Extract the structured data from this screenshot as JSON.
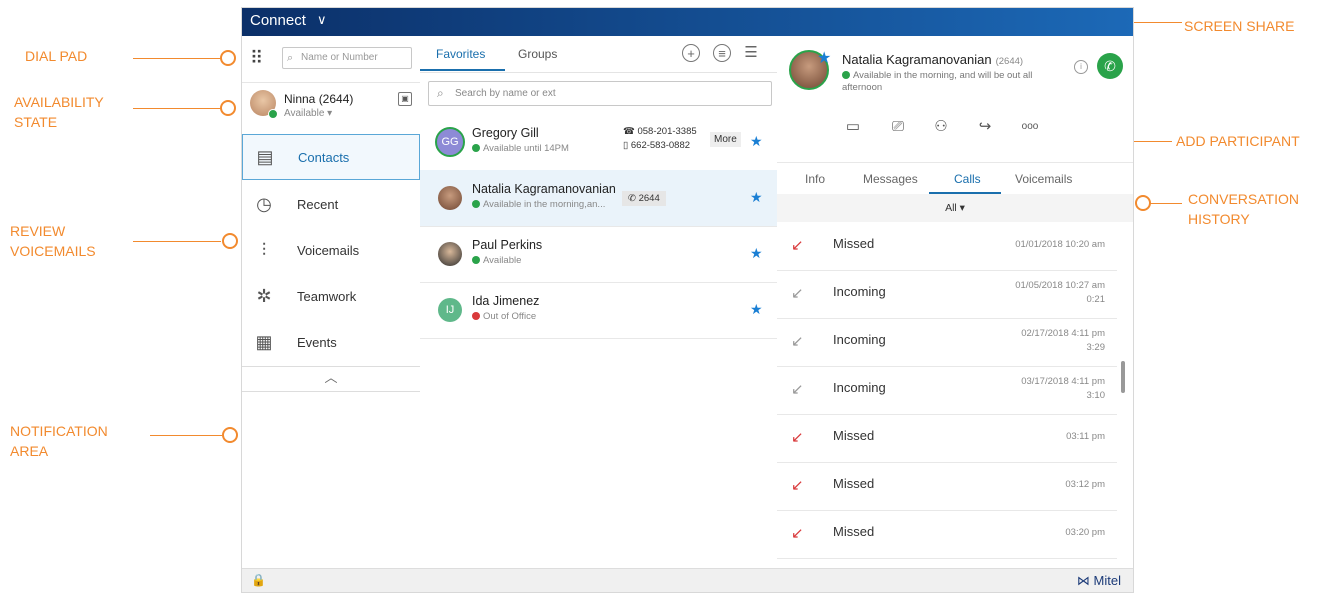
{
  "callouts": {
    "dial_pad": "DIAL PAD",
    "availability_line1": "AVAILABILITY",
    "availability_line2": "STATE",
    "review_line1": "REVIEW",
    "review_line2": "VOICEMAILS",
    "notification_line1": "NOTIFICATION",
    "notification_line2": "AREA",
    "screen_share": "SCREEN SHARE",
    "add_participant": "ADD PARTICIPANT",
    "conversation_line1": "CONVERSATION",
    "conversation_line2": "HISTORY",
    "color": "#f28a2e"
  },
  "app": {
    "title": "Connect",
    "title_chevron": "∨",
    "brand": "Mitel",
    "brand_icon": "mitel-logo-icon",
    "lock_icon": "lock-icon",
    "titlebar_colors": [
      "#0b2f68",
      "#1c69b7"
    ]
  },
  "sidebar": {
    "search_placeholder": "Name or Number",
    "dialpad_icon": "dialpad-icon",
    "user": {
      "name": "Ninna (2644)",
      "status": "Available ▾",
      "status_color": "#2aa34a"
    },
    "nav": [
      {
        "label": "Contacts",
        "icon": "contacts-icon",
        "active": true
      },
      {
        "label": "Recent",
        "icon": "clock-icon",
        "active": false
      },
      {
        "label": "Voicemails",
        "icon": "voicemail-wave-icon",
        "active": false
      },
      {
        "label": "Teamwork",
        "icon": "teamwork-icon",
        "active": false
      },
      {
        "label": "Events",
        "icon": "calendar-icon",
        "active": false
      }
    ],
    "collapse_glyph": "︿"
  },
  "contacts": {
    "tabs": [
      {
        "label": "Favorites",
        "active": true
      },
      {
        "label": "Groups",
        "active": false
      }
    ],
    "search_placeholder": "Search by name or ext",
    "list": [
      {
        "initials": "GG",
        "avatar_color": "#8d8ad6",
        "name": "Gregory Gill",
        "status": "Available until 14PM",
        "status_color": "#2aa34a",
        "phone1": "058-201-3385",
        "phone2": "662-583-0882",
        "more": "More",
        "favorite": true
      },
      {
        "name": "Natalia Kagramanovanian",
        "status": "Available in the morning,an...",
        "status_color": "#2aa34a",
        "ext": "2644",
        "favorite": true,
        "selected": true
      },
      {
        "name": "Paul Perkins",
        "status": "Available",
        "status_color": "#2aa34a",
        "favorite": true
      },
      {
        "initials": "IJ",
        "avatar_color": "#5fb88a",
        "name": "Ida Jimenez",
        "status": "Out of Office",
        "status_color": "#d9393b",
        "favorite": true
      }
    ]
  },
  "detail": {
    "name": "Natalia Kagramanovanian",
    "ext": "(2644)",
    "status": "Available in the morning, and will be out all afternoon",
    "status_color": "#2aa34a",
    "actions": [
      "video-icon",
      "screen-share-icon",
      "add-participant-icon",
      "transfer-icon",
      "more-options-icon"
    ],
    "more_glyph": "ooo",
    "tabs": [
      {
        "label": "Info",
        "active": false
      },
      {
        "label": "Messages",
        "active": false
      },
      {
        "label": "Calls",
        "active": true
      },
      {
        "label": "Voicemails",
        "active": false
      }
    ],
    "filter": "All ▾",
    "calls": [
      {
        "type": "Missed",
        "date": "01/01/2018  10:20 am",
        "duration": ""
      },
      {
        "type": "Incoming",
        "date": "01/05/2018 10:27 am",
        "duration": "0:21"
      },
      {
        "type": "Incoming",
        "date": "02/17/2018 4:11 pm",
        "duration": "3:29"
      },
      {
        "type": "Incoming",
        "date": "03/17/2018 4:11 pm",
        "duration": "3:10"
      },
      {
        "type": "Missed",
        "date": "03:11 pm",
        "duration": ""
      },
      {
        "type": "Missed",
        "date": "03:12 pm",
        "duration": ""
      },
      {
        "type": "Missed",
        "date": "03:20 pm",
        "duration": ""
      }
    ],
    "missed_color": "#d9393b"
  }
}
